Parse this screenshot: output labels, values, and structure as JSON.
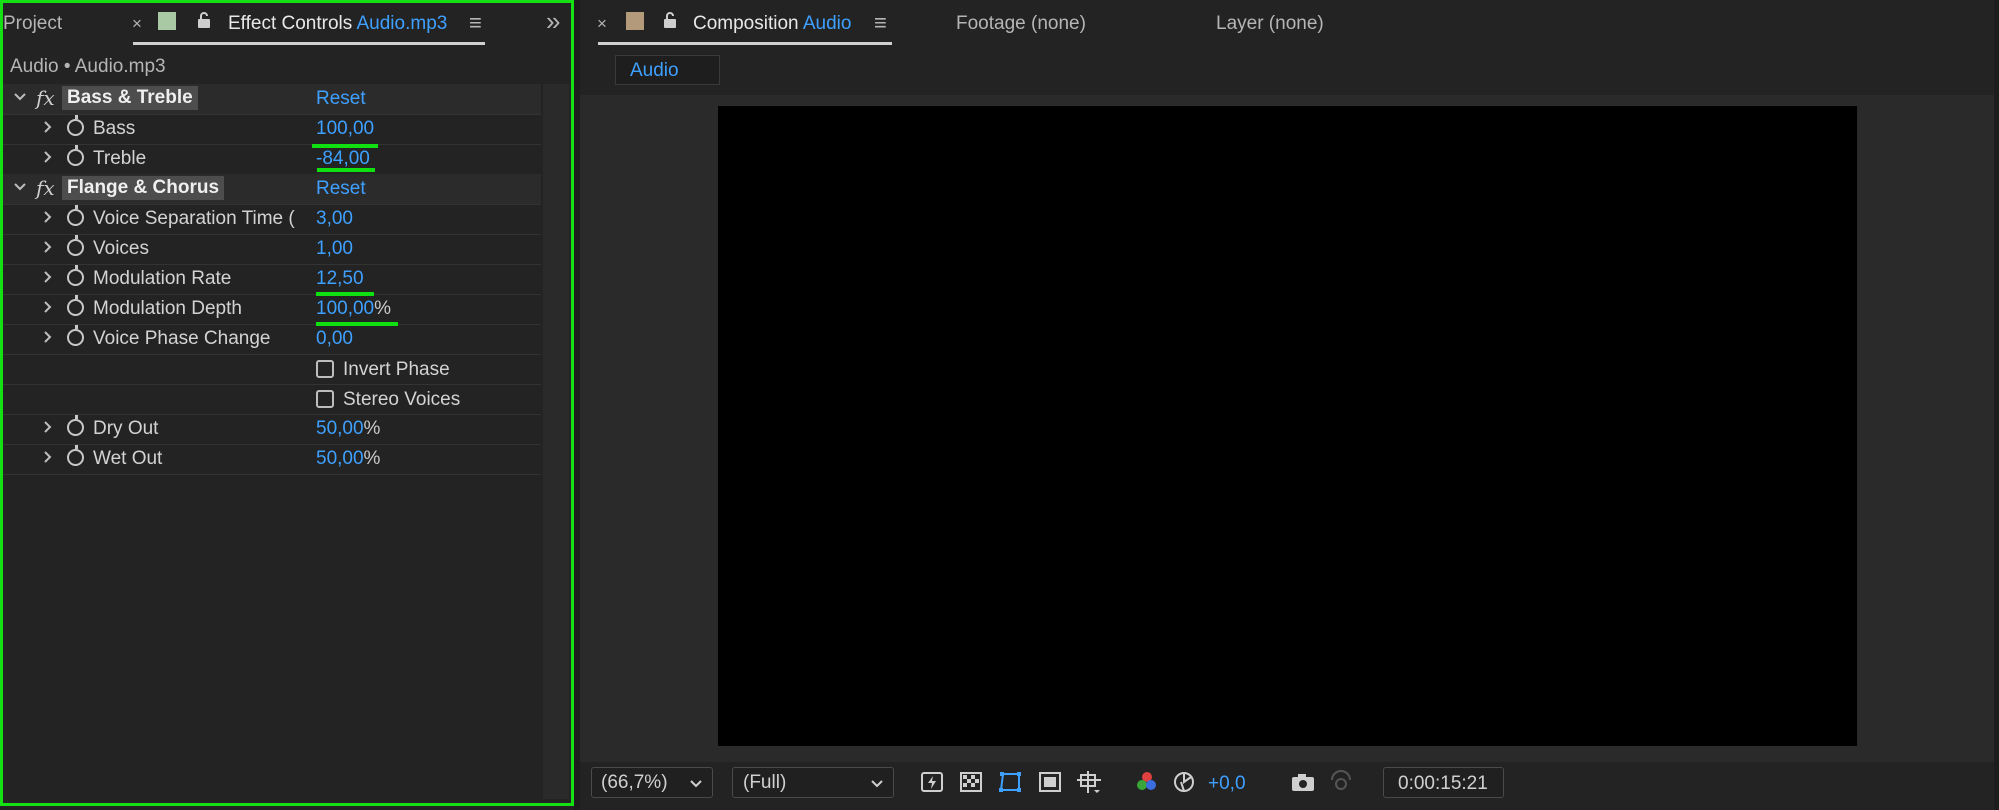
{
  "left_panel": {
    "tabs": {
      "project": "Project",
      "close_glyph": "×",
      "effect_controls_label": "Effect Controls",
      "effect_controls_file": "Audio.mp3",
      "menu_glyph": "≡",
      "overflow_glyph": "»"
    },
    "breadcrumb": "Audio • Audio.mp3",
    "effects": [
      {
        "fx": "fx",
        "name": "Bass & Treble",
        "reset": "Reset"
      },
      {
        "fx": "fx",
        "name": "Flange & Chorus",
        "reset": "Reset"
      }
    ],
    "params": [
      {
        "label": "Bass",
        "value": "100,00",
        "unit": ""
      },
      {
        "label": "Treble",
        "value": "-84,00",
        "unit": ""
      },
      {
        "label": "Voice Separation Time (",
        "value": "3,00",
        "unit": ""
      },
      {
        "label": "Voices",
        "value": "1,00",
        "unit": ""
      },
      {
        "label": "Modulation Rate",
        "value": "12,50",
        "unit": ""
      },
      {
        "label": "Modulation Depth",
        "value": "100,00",
        "unit": "%"
      },
      {
        "label": "Voice Phase Change",
        "value": "0,00",
        "unit": ""
      },
      {
        "label": "Dry Out",
        "value": "50,00",
        "unit": "%"
      },
      {
        "label": "Wet Out",
        "value": "50,00",
        "unit": "%"
      }
    ],
    "checkboxes": [
      {
        "label": "Invert Phase",
        "checked": false
      },
      {
        "label": "Stereo Voices",
        "checked": false
      }
    ]
  },
  "right_panel": {
    "tabs": {
      "close_glyph": "×",
      "composition_label": "Composition",
      "composition_name": "Audio",
      "menu_glyph": "≡",
      "footage": "Footage (none)",
      "layer": "Layer (none)"
    },
    "comp_tab": "Audio",
    "toolbar": {
      "zoom": "(66,7%)",
      "resolution": "(Full)",
      "exposure": "+0,0",
      "timecode": "0:00:15:21"
    }
  },
  "colors": {
    "accent_blue": "#3ea0ff",
    "highlight_green": "#14e014",
    "label_swatch_green": "#a9c9a4",
    "label_swatch_tan": "#b29a7a"
  }
}
